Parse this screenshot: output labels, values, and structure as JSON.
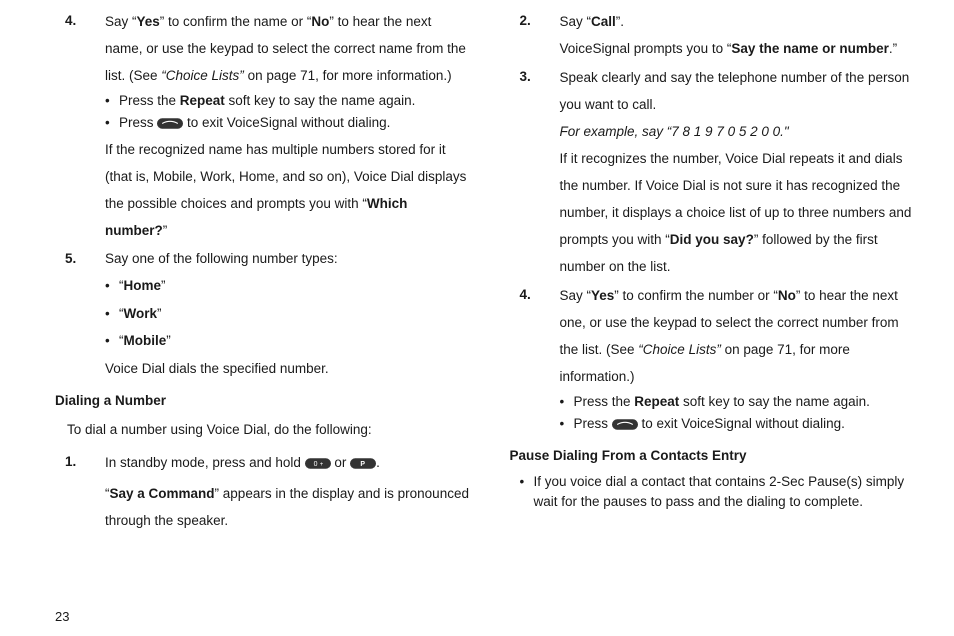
{
  "pageNumber": "23",
  "left": {
    "item4": {
      "num": "4.",
      "p1a": "Say “",
      "yes": "Yes",
      "p1b": "” to confirm the name or “",
      "no": "No",
      "p1c": "” to hear the next name, or use the keypad to select the correct name from the list. (See ",
      "ref": "“Choice Lists”",
      "p1d": " on page 71, for more information.)",
      "b1a": "Press the ",
      "b1repeat": "Repeat",
      "b1b": " soft key to say the name again.",
      "b2a": "Press ",
      "b2b": " to exit VoiceSignal without dialing.",
      "p2a": "If the recognized name has multiple numbers stored for it (that is, Mobile, Work, Home, and so on), Voice Dial displays the possible choices and prompts you with “",
      "which": "Which number?",
      "p2b": "”"
    },
    "item5": {
      "num": "5.",
      "p1": "Say one of the following number types:",
      "home": "Home",
      "work": "Work",
      "mobile": "Mobile",
      "p2": "Voice Dial dials the specified number."
    },
    "dialHeading": "Dialing a Number",
    "dialIntro": "To dial a number using Voice Dial, do the following:",
    "d1": {
      "num": "1.",
      "p1a": "In standby mode, press and hold ",
      "p1b": " or ",
      "p1c": ".",
      "p2a": "“",
      "cmd": "Say a Command",
      "p2b": "” appears in the display and is pronounced through the speaker."
    }
  },
  "right": {
    "d2": {
      "num": "2.",
      "p1a": "Say “",
      "call": "Call",
      "p1b": "”.",
      "p2a": "VoiceSignal prompts you to “",
      "say": "Say the name or number",
      "p2b": ".”"
    },
    "d3": {
      "num": "3.",
      "p1": "Speak clearly and say the telephone number of the person you want to call.",
      "ex": "For example, say “7 8 1 9 7 0 5 2 0 0.\"",
      "p2a": "If it recognizes the number, Voice Dial repeats it and dials the number. If Voice Dial is not sure it has recognized the number, it displays a choice list of up to three numbers and prompts you with “",
      "did": "Did you say?",
      "p2b": "” followed by the first number on the list."
    },
    "d4": {
      "num": "4.",
      "p1a": "Say “",
      "yes": "Yes",
      "p1b": "” to confirm the number or “",
      "no": "No",
      "p1c": "” to hear the next one, or use the keypad to select the correct number from the list. (See ",
      "ref": "“Choice Lists”",
      "p1d": " on page 71, for more information.)",
      "b1a": "Press the ",
      "b1repeat": "Repeat",
      "b1b": " soft key to say the name again.",
      "b2a": "Press ",
      "b2b": " to exit VoiceSignal without dialing."
    },
    "pauseHeading": "Pause Dialing From a Contacts Entry",
    "pauseBullet": "If you voice dial a contact that contains 2-Sec Pause(s) simply wait for the pauses to pass and the dialing to complete."
  }
}
